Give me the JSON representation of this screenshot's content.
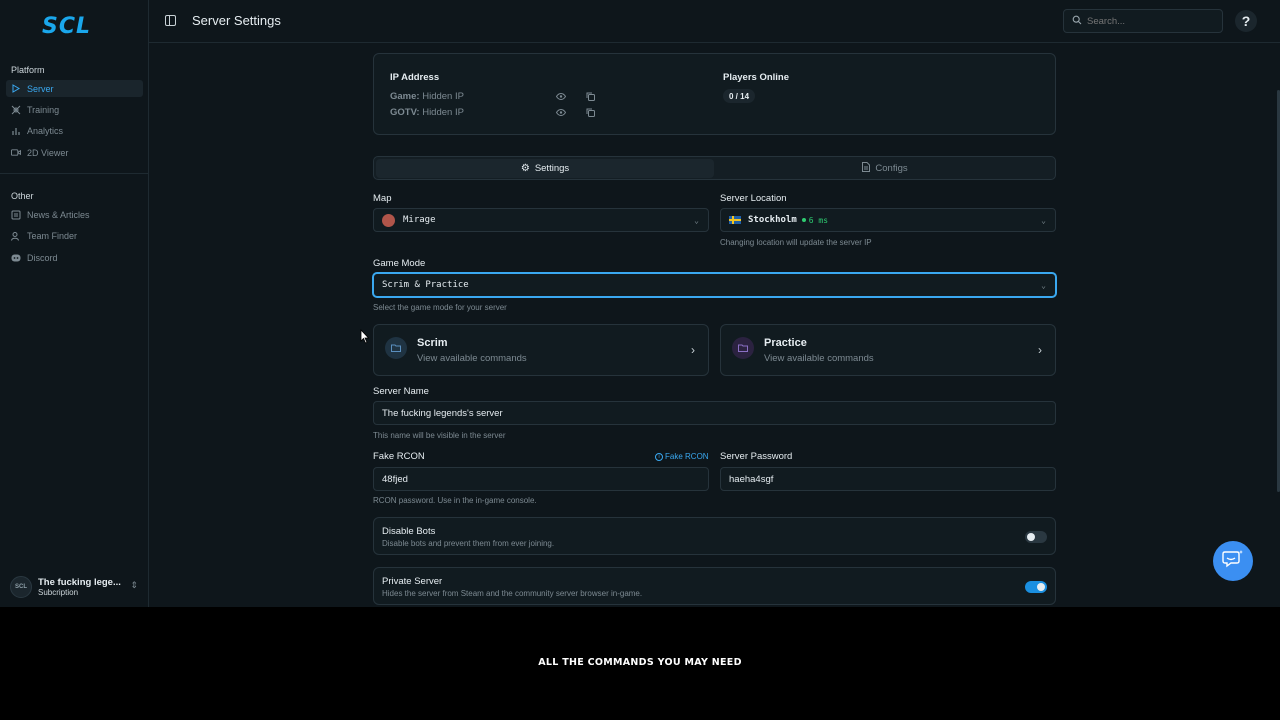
{
  "app": {
    "logo": "SCL",
    "page_title": "Server Settings"
  },
  "sidebar": {
    "platform_label": "Platform",
    "platform_items": [
      {
        "label": "Server",
        "icon": "play-icon",
        "active": true
      },
      {
        "label": "Training",
        "icon": "crosshair-icon"
      },
      {
        "label": "Analytics",
        "icon": "chart-icon"
      },
      {
        "label": "2D Viewer",
        "icon": "video-icon"
      }
    ],
    "other_label": "Other",
    "other_items": [
      {
        "label": "News & Articles",
        "icon": "newspaper-icon"
      },
      {
        "label": "Team Finder",
        "icon": "users-icon"
      },
      {
        "label": "Discord",
        "icon": "discord-icon"
      }
    ],
    "user": {
      "name": "The fucking lege...",
      "plan": "Subcription"
    }
  },
  "header": {
    "search_placeholder": "Search..."
  },
  "server_info": {
    "ip_label": "IP Address",
    "game_label": "Game:",
    "game_value": "Hidden IP",
    "gotv_label": "GOTV:",
    "gotv_value": "Hidden IP",
    "players_label": "Players Online",
    "players_value": "0 / 14"
  },
  "tabs": {
    "settings": "Settings",
    "configs": "Configs"
  },
  "form": {
    "map_label": "Map",
    "map_value": "Mirage",
    "location_label": "Server Location",
    "location_value": "Stockholm",
    "location_ping": "6 ms",
    "location_hint": "Changing location will update the server IP",
    "mode_label": "Game Mode",
    "mode_value": "Scrim & Practice",
    "mode_hint": "Select the game mode for your server",
    "scrim_title": "Scrim",
    "scrim_sub": "View available commands",
    "practice_title": "Practice",
    "practice_sub": "View available commands",
    "name_label": "Server Name",
    "name_value": "The fucking legends's server",
    "name_hint": "This name will be visible in the server",
    "rcon_label": "Fake RCON",
    "rcon_link": "Fake RCON",
    "rcon_value": "48fjed",
    "rcon_hint": "RCON password. Use in the in-game console.",
    "password_label": "Server Password",
    "password_value": "haeha4sgf",
    "bots_title": "Disable Bots",
    "bots_desc": "Disable bots and prevent them from ever joining.",
    "bots_on": false,
    "private_title": "Private Server",
    "private_desc": "Hides the server from Steam and the community server browser in-game.",
    "private_on": true
  },
  "footer": {
    "banner_text": "ALL THE COMMANDS YOU MAY NEED"
  },
  "colors": {
    "accent": "#3aa8f0",
    "toggle_on": "#1a8fe0",
    "chat_button": "#3b8ff2",
    "ping_green": "#2ecc71"
  }
}
